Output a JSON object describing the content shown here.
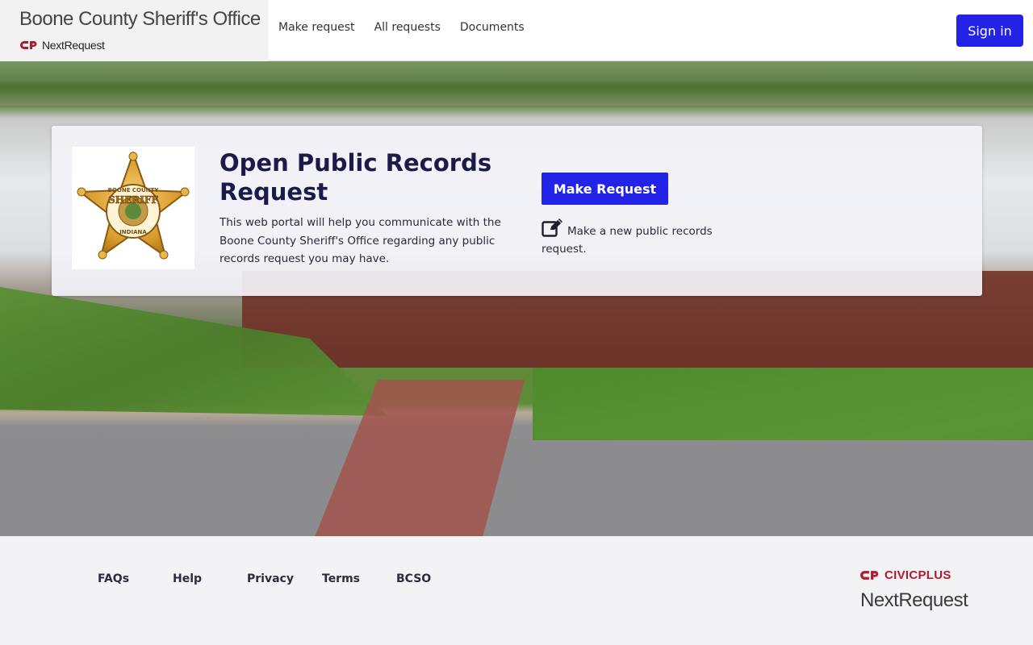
{
  "header": {
    "org_name": "Boone County Sheriff's Office",
    "product_name": "NextRequest",
    "nav": [
      {
        "label": "Make request"
      },
      {
        "label": "All requests"
      },
      {
        "label": "Documents"
      }
    ],
    "sign_in_label": "Sign in"
  },
  "hero": {
    "title": "Open Public Records Request",
    "description": "This web portal will help you communicate with the Boone County Sheriff's Office regarding any public records request you may have.",
    "make_request_label": "Make Request",
    "make_request_note": "Make a new public records request.",
    "badge_text_top": "BOONE COUNTY",
    "badge_text_middle": "SHERIFF",
    "badge_text_bottom": "INDIANA"
  },
  "footer": {
    "links": [
      {
        "label": "FAQs"
      },
      {
        "label": "Help"
      },
      {
        "label": "Privacy"
      },
      {
        "label": "Terms"
      },
      {
        "label": "BCSO"
      }
    ],
    "vendor": "CIVICPLUS",
    "vendor_product": "NextRequest"
  },
  "colors": {
    "primary": "#2323e8",
    "heading": "#1b1a48",
    "civicplus_red": "#b01c2e"
  }
}
